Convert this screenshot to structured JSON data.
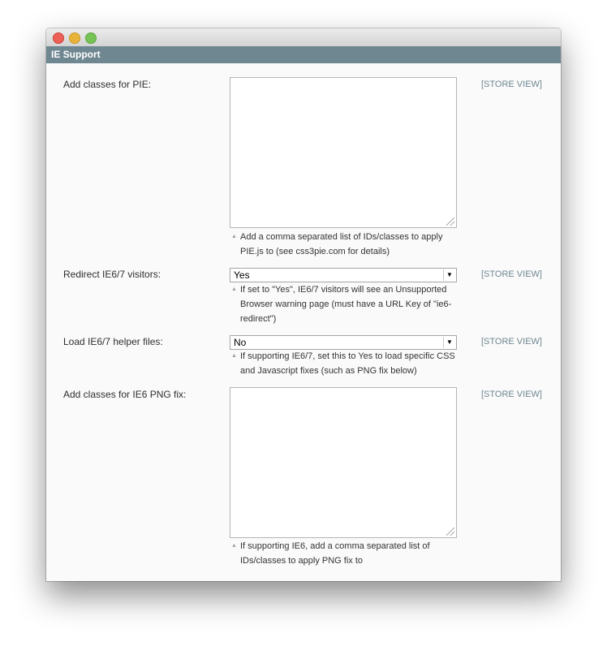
{
  "window": {
    "title": "IE Support"
  },
  "fields": [
    {
      "label": "Add classes for PIE:",
      "type": "textarea",
      "value": "",
      "note": "Add a comma separated list of IDs/classes to apply PIE.js to (see css3pie.com for details)",
      "scope": "[STORE VIEW]"
    },
    {
      "label": "Redirect IE6/7 visitors:",
      "type": "select",
      "value": "Yes",
      "note": "If set to \"Yes\", IE6/7 visitors will see an Unsupported Browser warning page (must have a URL Key of \"ie6-redirect\")",
      "scope": "[STORE VIEW]"
    },
    {
      "label": "Load IE6/7 helper files:",
      "type": "select",
      "value": "No",
      "note": "If supporting IE6/7, set this to Yes to load specific CSS and Javascript fixes (such as PNG fix below)",
      "scope": "[STORE VIEW]"
    },
    {
      "label": "Add classes for IE6 PNG fix:",
      "type": "textarea",
      "value": "",
      "note": "If supporting IE6, add a comma separated list of IDs/classes to apply PNG fix to",
      "scope": "[STORE VIEW]"
    }
  ]
}
